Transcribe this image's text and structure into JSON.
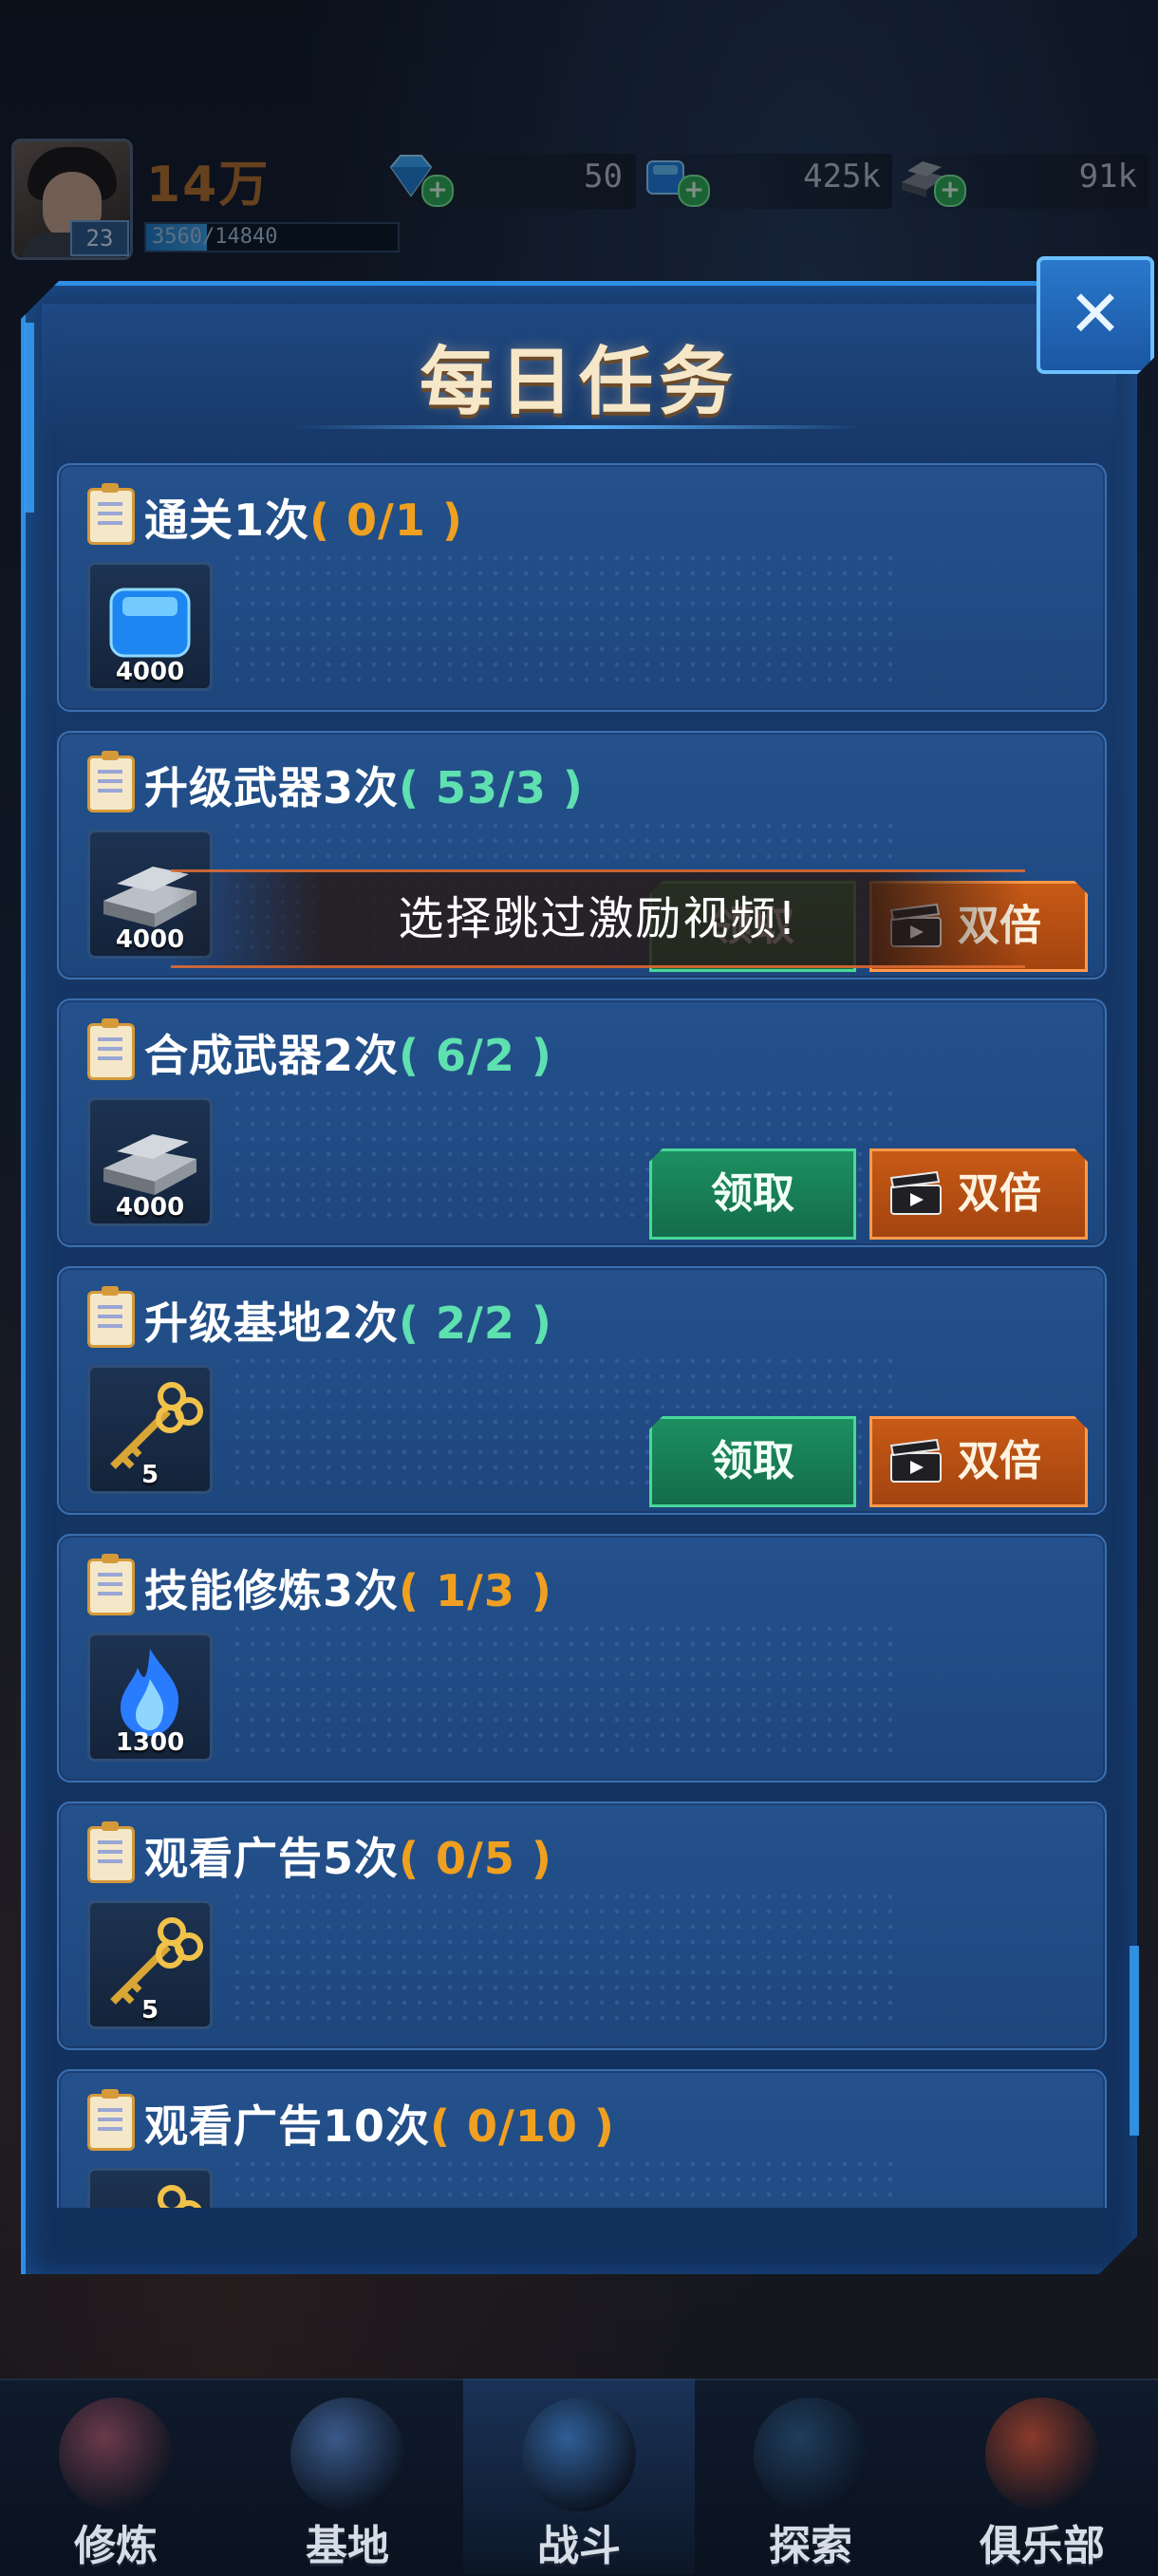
{
  "header": {
    "power": "14万",
    "level": "23",
    "exp_text": "3560/14840",
    "exp_progress": 0.24,
    "resources": [
      {
        "icon": "diamond-icon",
        "value": "50"
      },
      {
        "icon": "blue-cube-icon",
        "value": "425k"
      },
      {
        "icon": "iron-ingot-icon",
        "value": "91k"
      }
    ]
  },
  "dialog": {
    "title": "每日任务",
    "close_icon": "close-icon"
  },
  "tasks": [
    {
      "title": "通关1次",
      "progress": "( 0/1 )",
      "progress_color": "orange",
      "reward_icon": "blue-cube-icon",
      "reward_qty": "4000",
      "show_buttons": false
    },
    {
      "title": "升级武器3次",
      "progress": "( 53/3 )",
      "progress_color": "green",
      "reward_icon": "iron-ingot-icon",
      "reward_qty": "4000",
      "show_buttons": true
    },
    {
      "title": "合成武器2次",
      "progress": "( 6/2 )",
      "progress_color": "green",
      "reward_icon": "iron-ingot-icon",
      "reward_qty": "4000",
      "show_buttons": true
    },
    {
      "title": "升级基地2次",
      "progress": "( 2/2 )",
      "progress_color": "green",
      "reward_icon": "gold-key-icon",
      "reward_qty": "5",
      "show_buttons": true
    },
    {
      "title": "技能修炼3次",
      "progress": "( 1/3 )",
      "progress_color": "orange",
      "reward_icon": "blue-flame-icon",
      "reward_qty": "1300",
      "show_buttons": false
    },
    {
      "title": "观看广告5次",
      "progress": "( 0/5 )",
      "progress_color": "orange",
      "reward_icon": "gold-key-icon",
      "reward_qty": "5",
      "show_buttons": false
    },
    {
      "title": "观看广告10次",
      "progress": "( 0/10 )",
      "progress_color": "orange",
      "reward_icon": "gold-key-icon",
      "reward_qty": "",
      "show_buttons": false
    }
  ],
  "buttons": {
    "claim": "领取",
    "double": "双倍"
  },
  "toast": "选择跳过激励视频!",
  "nav": [
    {
      "label": "修炼",
      "icon": "cultivate-icon",
      "active": false
    },
    {
      "label": "基地",
      "icon": "base-icon",
      "active": false
    },
    {
      "label": "战斗",
      "icon": "battle-icon",
      "active": true
    },
    {
      "label": "探索",
      "icon": "explore-icon",
      "active": false
    },
    {
      "label": "俱乐部",
      "icon": "club-icon",
      "active": false
    }
  ],
  "colors": {
    "accent_blue": "#2f8fe6",
    "progress_orange": "#f0a020",
    "progress_green": "#5fe0b0",
    "claim_green": "#1c9060",
    "double_orange": "#c85a16"
  }
}
